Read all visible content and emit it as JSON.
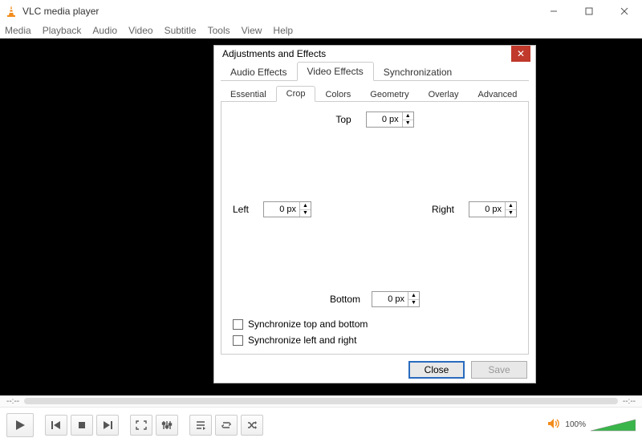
{
  "window": {
    "title": "VLC media player"
  },
  "menu": [
    "Media",
    "Playback",
    "Audio",
    "Video",
    "Subtitle",
    "Tools",
    "View",
    "Help"
  ],
  "dialog": {
    "title": "Adjustments and Effects",
    "mainTabs": [
      "Audio Effects",
      "Video Effects",
      "Synchronization"
    ],
    "mainActiveIndex": 1,
    "subTabs": [
      "Essential",
      "Crop",
      "Colors",
      "Geometry",
      "Overlay",
      "Advanced"
    ],
    "subActiveIndex": 1,
    "crop": {
      "topLabel": "Top",
      "topValue": "0 px",
      "leftLabel": "Left",
      "leftValue": "0 px",
      "rightLabel": "Right",
      "rightValue": "0 px",
      "bottomLabel": "Bottom",
      "bottomValue": "0 px",
      "syncTB": "Synchronize top and bottom",
      "syncLR": "Synchronize left and right"
    },
    "buttons": {
      "close": "Close",
      "save": "Save"
    }
  },
  "seek": {
    "elapsed": "--:--",
    "total": "--:--"
  },
  "volume": {
    "percent": "100%"
  }
}
